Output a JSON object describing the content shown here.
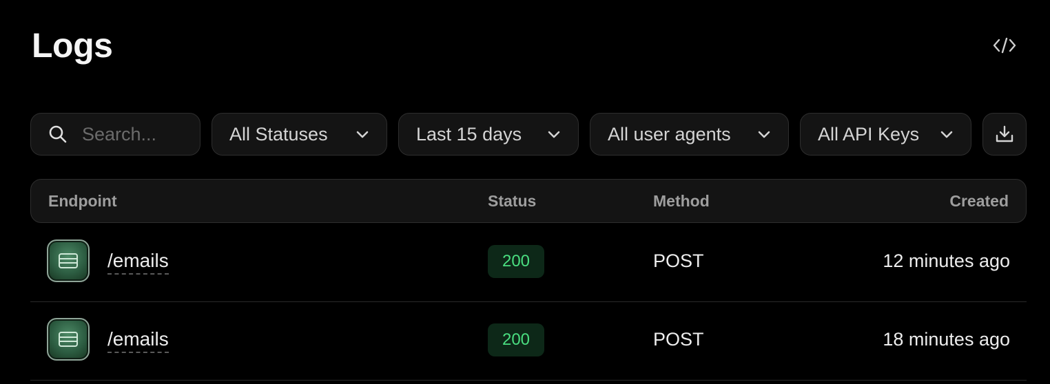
{
  "page": {
    "title": "Logs"
  },
  "toolbar": {
    "search": {
      "placeholder": "Search...",
      "value": ""
    },
    "status_filter": "All Statuses",
    "date_filter": "Last 15 days",
    "user_agent_filter": "All user agents",
    "api_key_filter": "All API Keys"
  },
  "table": {
    "columns": {
      "endpoint": "Endpoint",
      "status": "Status",
      "method": "Method",
      "created": "Created"
    },
    "rows": [
      {
        "endpoint": "/emails",
        "status": "200",
        "method": "POST",
        "created": "12 minutes ago"
      },
      {
        "endpoint": "/emails",
        "status": "200",
        "method": "POST",
        "created": "18 minutes ago"
      }
    ]
  },
  "colors": {
    "background": "#000000",
    "success_text": "#4ade80",
    "success_bg": "#0d2818"
  },
  "icons": [
    "code-icon",
    "search-icon",
    "chevron-down-icon",
    "download-icon",
    "email-endpoint-icon"
  ]
}
